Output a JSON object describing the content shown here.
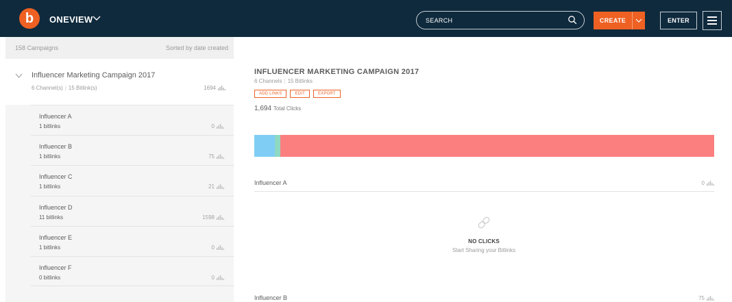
{
  "topbar": {
    "logo_letter": "b",
    "brand": "ONEVIEW",
    "search_placeholder": "SEARCH",
    "create_label": "CREATE",
    "enter_label": "ENTER"
  },
  "sidebar": {
    "campaign_count": "158 Campaigns",
    "sort_label": "Sorted by date created",
    "campaign": {
      "title": "Influencer Marketing Campaign 2017",
      "channels": "6 Channel(s)",
      "bitlinks": "15 Bitlink(s)",
      "clicks": "1694"
    },
    "channels": [
      {
        "name": "Influencer A",
        "bitlinks": "1 bitlinks",
        "clicks": "0"
      },
      {
        "name": "Influencer B",
        "bitlinks": "1 bitlinks",
        "clicks": "75"
      },
      {
        "name": "Influencer C",
        "bitlinks": "1 bitlinks",
        "clicks": "21"
      },
      {
        "name": "Influencer D",
        "bitlinks": "11 bitlinks",
        "clicks": "1598"
      },
      {
        "name": "Influencer E",
        "bitlinks": "1 bitlinks",
        "clicks": "0"
      },
      {
        "name": "Influencer F",
        "bitlinks": "0 bitlinks",
        "clicks": "0"
      }
    ]
  },
  "main": {
    "title": "INFLUENCER MARKETING CAMPAIGN 2017",
    "channels": "6 Channels",
    "bitlinks": "15 Bitlinks",
    "actions": [
      "ADD LINKS",
      "EDIT",
      "EXPORT"
    ],
    "total_clicks": "1,694",
    "total_label": "Total Clicks",
    "breakdown": [
      {
        "channel": "Influencer B",
        "clicks": 75,
        "color": "#7fcdf5"
      },
      {
        "channel": "Influencer C",
        "clicks": 21,
        "color": "#8ed9c2"
      },
      {
        "channel": "Influencer D",
        "clicks": 1598,
        "color": "#fb7f7f"
      }
    ],
    "rows": [
      {
        "name": "Influencer A",
        "clicks": "0"
      },
      {
        "name": "Influencer B",
        "clicks": "75"
      }
    ],
    "empty": {
      "title": "NO CLICKS",
      "subtitle": "Start Sharing your Bitlinks"
    }
  },
  "colors": {
    "accent": "#ee6123",
    "nav_bg": "#0f2a3d"
  }
}
